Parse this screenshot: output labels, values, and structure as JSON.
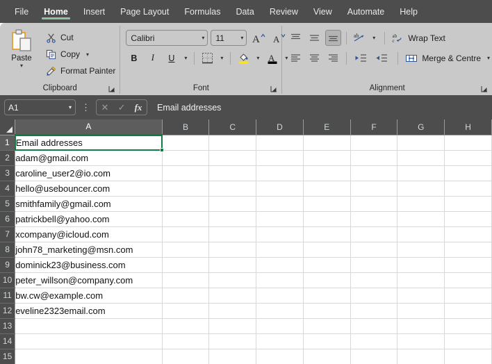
{
  "tabs": [
    {
      "label": "File",
      "active": false
    },
    {
      "label": "Home",
      "active": true
    },
    {
      "label": "Insert",
      "active": false
    },
    {
      "label": "Page Layout",
      "active": false
    },
    {
      "label": "Formulas",
      "active": false
    },
    {
      "label": "Data",
      "active": false
    },
    {
      "label": "Review",
      "active": false
    },
    {
      "label": "View",
      "active": false
    },
    {
      "label": "Automate",
      "active": false
    },
    {
      "label": "Help",
      "active": false
    }
  ],
  "ribbon": {
    "clipboard": {
      "group_label": "Clipboard",
      "paste_label": "Paste",
      "cut_label": "Cut",
      "copy_label": "Copy",
      "format_painter_label": "Format Painter"
    },
    "font": {
      "group_label": "Font",
      "font_name": "Calibri",
      "font_size": "11",
      "bold_label": "B",
      "italic_label": "I",
      "underline_label": "U",
      "grow_font_label": "A",
      "shrink_font_label": "A"
    },
    "alignment": {
      "group_label": "Alignment",
      "wrap_text_label": "Wrap Text",
      "merge_centre_label": "Merge & Centre"
    }
  },
  "formula_bar": {
    "name_box": "A1",
    "formula_value": "Email addresses"
  },
  "grid": {
    "columns": [
      "A",
      "B",
      "C",
      "D",
      "E",
      "F",
      "G",
      "H"
    ],
    "selected_column": "A",
    "active_cell": "A1",
    "rows": [
      {
        "num": "1",
        "a": "Email addresses"
      },
      {
        "num": "2",
        "a": "adam@gmail.com"
      },
      {
        "num": "3",
        "a": "caroline_user2@io.com"
      },
      {
        "num": "4",
        "a": "hello@usebouncer.com"
      },
      {
        "num": "5",
        "a": "smithfamily@gmail.com"
      },
      {
        "num": "6",
        "a": "patrickbell@yahoo.com"
      },
      {
        "num": "7",
        "a": "xcompany@icloud.com"
      },
      {
        "num": "8",
        "a": "john78_marketing@msn.com"
      },
      {
        "num": "9",
        "a": "dominick23@business.com"
      },
      {
        "num": "10",
        "a": "peter_willson@company.com"
      },
      {
        "num": "11",
        "a": "bw.cw@example.com"
      },
      {
        "num": "12",
        "a": "eveline2323email.com"
      },
      {
        "num": "13",
        "a": ""
      },
      {
        "num": "14",
        "a": ""
      },
      {
        "num": "15",
        "a": ""
      }
    ]
  },
  "colors": {
    "chrome": "#4d4d4d",
    "ribbon": "#c9c9c9",
    "accent_green": "#107c41",
    "tab_underline": "#8fc2a0",
    "highlight_yellow": "#ffe600"
  }
}
